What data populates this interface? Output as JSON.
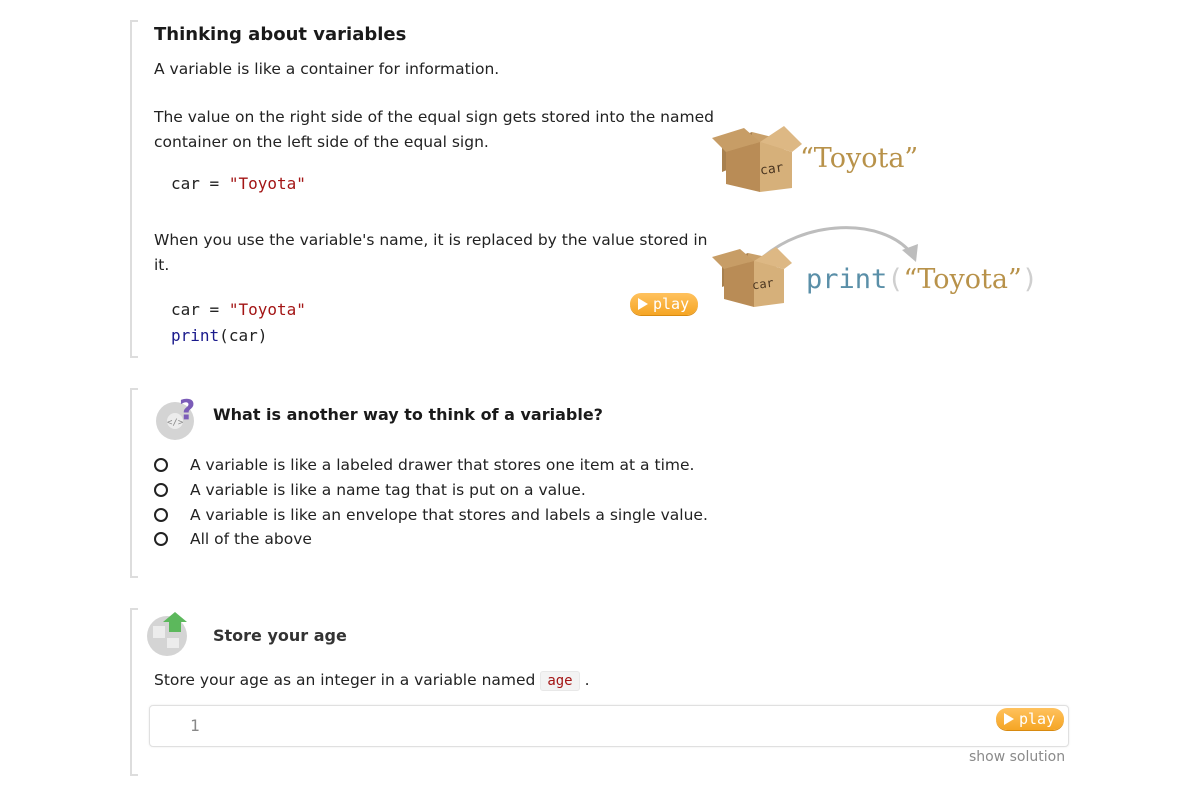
{
  "section1": {
    "title": "Thinking about variables",
    "intro": "A variable is like a container for information.",
    "para1_line1": "The value on the right side of the equal sign gets stored into the named",
    "para1_line2": "container on the left side of the equal sign.",
    "code1": {
      "var": "car",
      "op": "=",
      "value": "\"Toyota\""
    },
    "para2_line1": "When you use the variable's name, it is replaced by the value stored in",
    "para2_line2": "it.",
    "code2": {
      "var": "car",
      "op": "=",
      "value": "\"Toyota\"",
      "fn": "print",
      "open": "(",
      "arg": "car",
      "close": ")"
    },
    "play_label": "play",
    "illustration": {
      "box_label": "car",
      "stored_value": "“Toyota”",
      "print_fn": "print",
      "paren_open": "(",
      "paren_close": ")"
    }
  },
  "question": {
    "title": "What is another way to think of a variable?",
    "options": [
      "A variable is like a labeled drawer that stores one item at a time.",
      "A variable is like a name tag that is put on a value.",
      "A variable is like an envelope that stores and labels a single value.",
      "All of the above"
    ]
  },
  "exercise": {
    "title": "Store your age",
    "prompt_before": "Store your age as an integer in a variable named",
    "prompt_code": "age",
    "prompt_after": ".",
    "line_number": "1",
    "play_label": "play",
    "show_solution": "show solution"
  },
  "colors": {
    "play": "#f5a524",
    "string": "#a31515",
    "keyword": "#1a1a8c",
    "toyota": "#b8924a",
    "print": "#5a8fa8"
  }
}
